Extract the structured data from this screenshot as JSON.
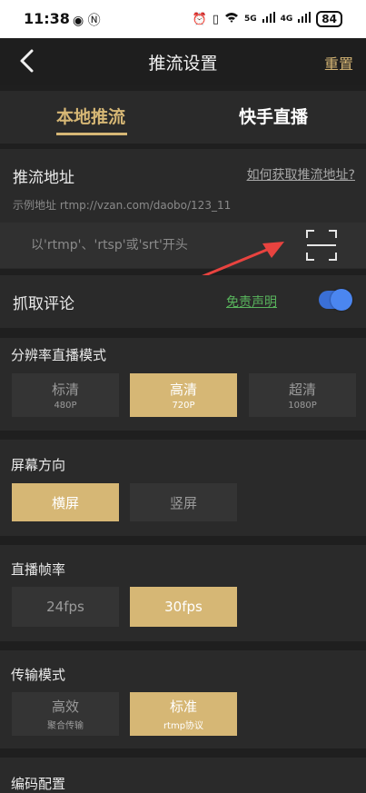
{
  "status": {
    "time": "11:38",
    "battery": "84",
    "network": "4G",
    "net5g": "5G"
  },
  "nav": {
    "title": "推流设置",
    "reset": "重置"
  },
  "tabs": [
    {
      "label": "本地推流",
      "active": true
    },
    {
      "label": "快手直播",
      "active": false
    }
  ],
  "stream": {
    "label": "推流地址",
    "help_link": "如何获取推流地址?",
    "example": "示例地址 rtmp://vzan.com/daobo/123_11",
    "input_value": "",
    "input_placeholder": "以'rtmp'、'rtsp'或'srt'开头"
  },
  "comments": {
    "label": "抓取评论",
    "disclaimer": "免责声明",
    "enabled": true
  },
  "resolution": {
    "label": "分辨率直播模式",
    "options": [
      {
        "title": "标清",
        "sub": "480P",
        "selected": false
      },
      {
        "title": "高清",
        "sub": "720P",
        "selected": true
      },
      {
        "title": "超清",
        "sub": "1080P",
        "selected": false
      }
    ]
  },
  "orientation": {
    "label": "屏幕方向",
    "options": [
      {
        "title": "横屏",
        "selected": true
      },
      {
        "title": "竖屏",
        "selected": false
      }
    ]
  },
  "framerate": {
    "label": "直播帧率",
    "options": [
      {
        "title": "24fps",
        "selected": false
      },
      {
        "title": "30fps",
        "selected": true
      }
    ]
  },
  "transport": {
    "label": "传输模式",
    "options": [
      {
        "title": "高效",
        "sub": "聚合传输",
        "selected": false
      },
      {
        "title": "标准",
        "sub": "rtmp协议",
        "selected": true
      }
    ]
  },
  "encoding": {
    "label": "编码配置"
  },
  "colors": {
    "accent": "#d6b775",
    "toggle": "#4b86f0",
    "arrow": "#e8433f"
  }
}
